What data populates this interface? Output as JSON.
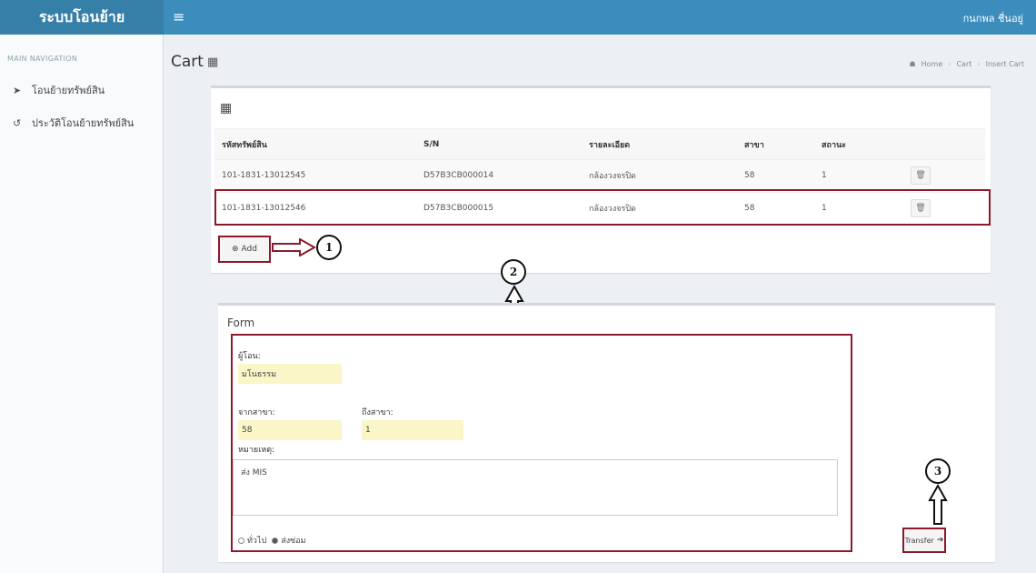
{
  "app": {
    "brand": "ระบบโอนย้าย",
    "user_name": "กนกพล ชื่นอยู่"
  },
  "sidebar": {
    "header": "MAIN NAVIGATION",
    "items": [
      {
        "label": "โอนย้ายทรัพย์สิน",
        "icon": "send-icon"
      },
      {
        "label": "ประวัติโอนย้ายทรัพย์สิน",
        "icon": "history-icon"
      }
    ]
  },
  "page": {
    "title": "Cart"
  },
  "breadcrumb": [
    "Home",
    "Cart",
    "Insert Cart"
  ],
  "cart": {
    "headers": [
      "รหัสทรัพย์สิน",
      "S/N",
      "รายละเอียด",
      "สาขา",
      "สถานะ"
    ],
    "rows": [
      {
        "asset_code": "101-1831-13012545",
        "sn": "D57B3CB000014",
        "detail": "กล้องวงจรปิด",
        "branch": "58",
        "status": "1"
      },
      {
        "asset_code": "101-1831-13012546",
        "sn": "D57B3CB000015",
        "detail": "กล้องวงจรปิด",
        "branch": "58",
        "status": "1"
      }
    ],
    "add_label": "Add"
  },
  "form": {
    "title": "Form",
    "sender_label": "ผู้โอน:",
    "sender_value": "มโนธรรม",
    "from_branch_label": "จากสาขา:",
    "from_branch_value": "58",
    "to_branch_label": "ถึงสาขา:",
    "to_branch_value": "1",
    "note_label": "หมายเหตุ:",
    "note_value": "ส่ง MIS",
    "radio_general": "ทั่วไป",
    "radio_repair": "ส่งซ่อม",
    "transfer_label": "Transfer"
  },
  "callouts": [
    "1",
    "2",
    "3"
  ],
  "colors": {
    "header": "#3c8dbc",
    "brand": "#367fa9",
    "highlight": "#8b1a2b",
    "input": "#faf6c8"
  }
}
